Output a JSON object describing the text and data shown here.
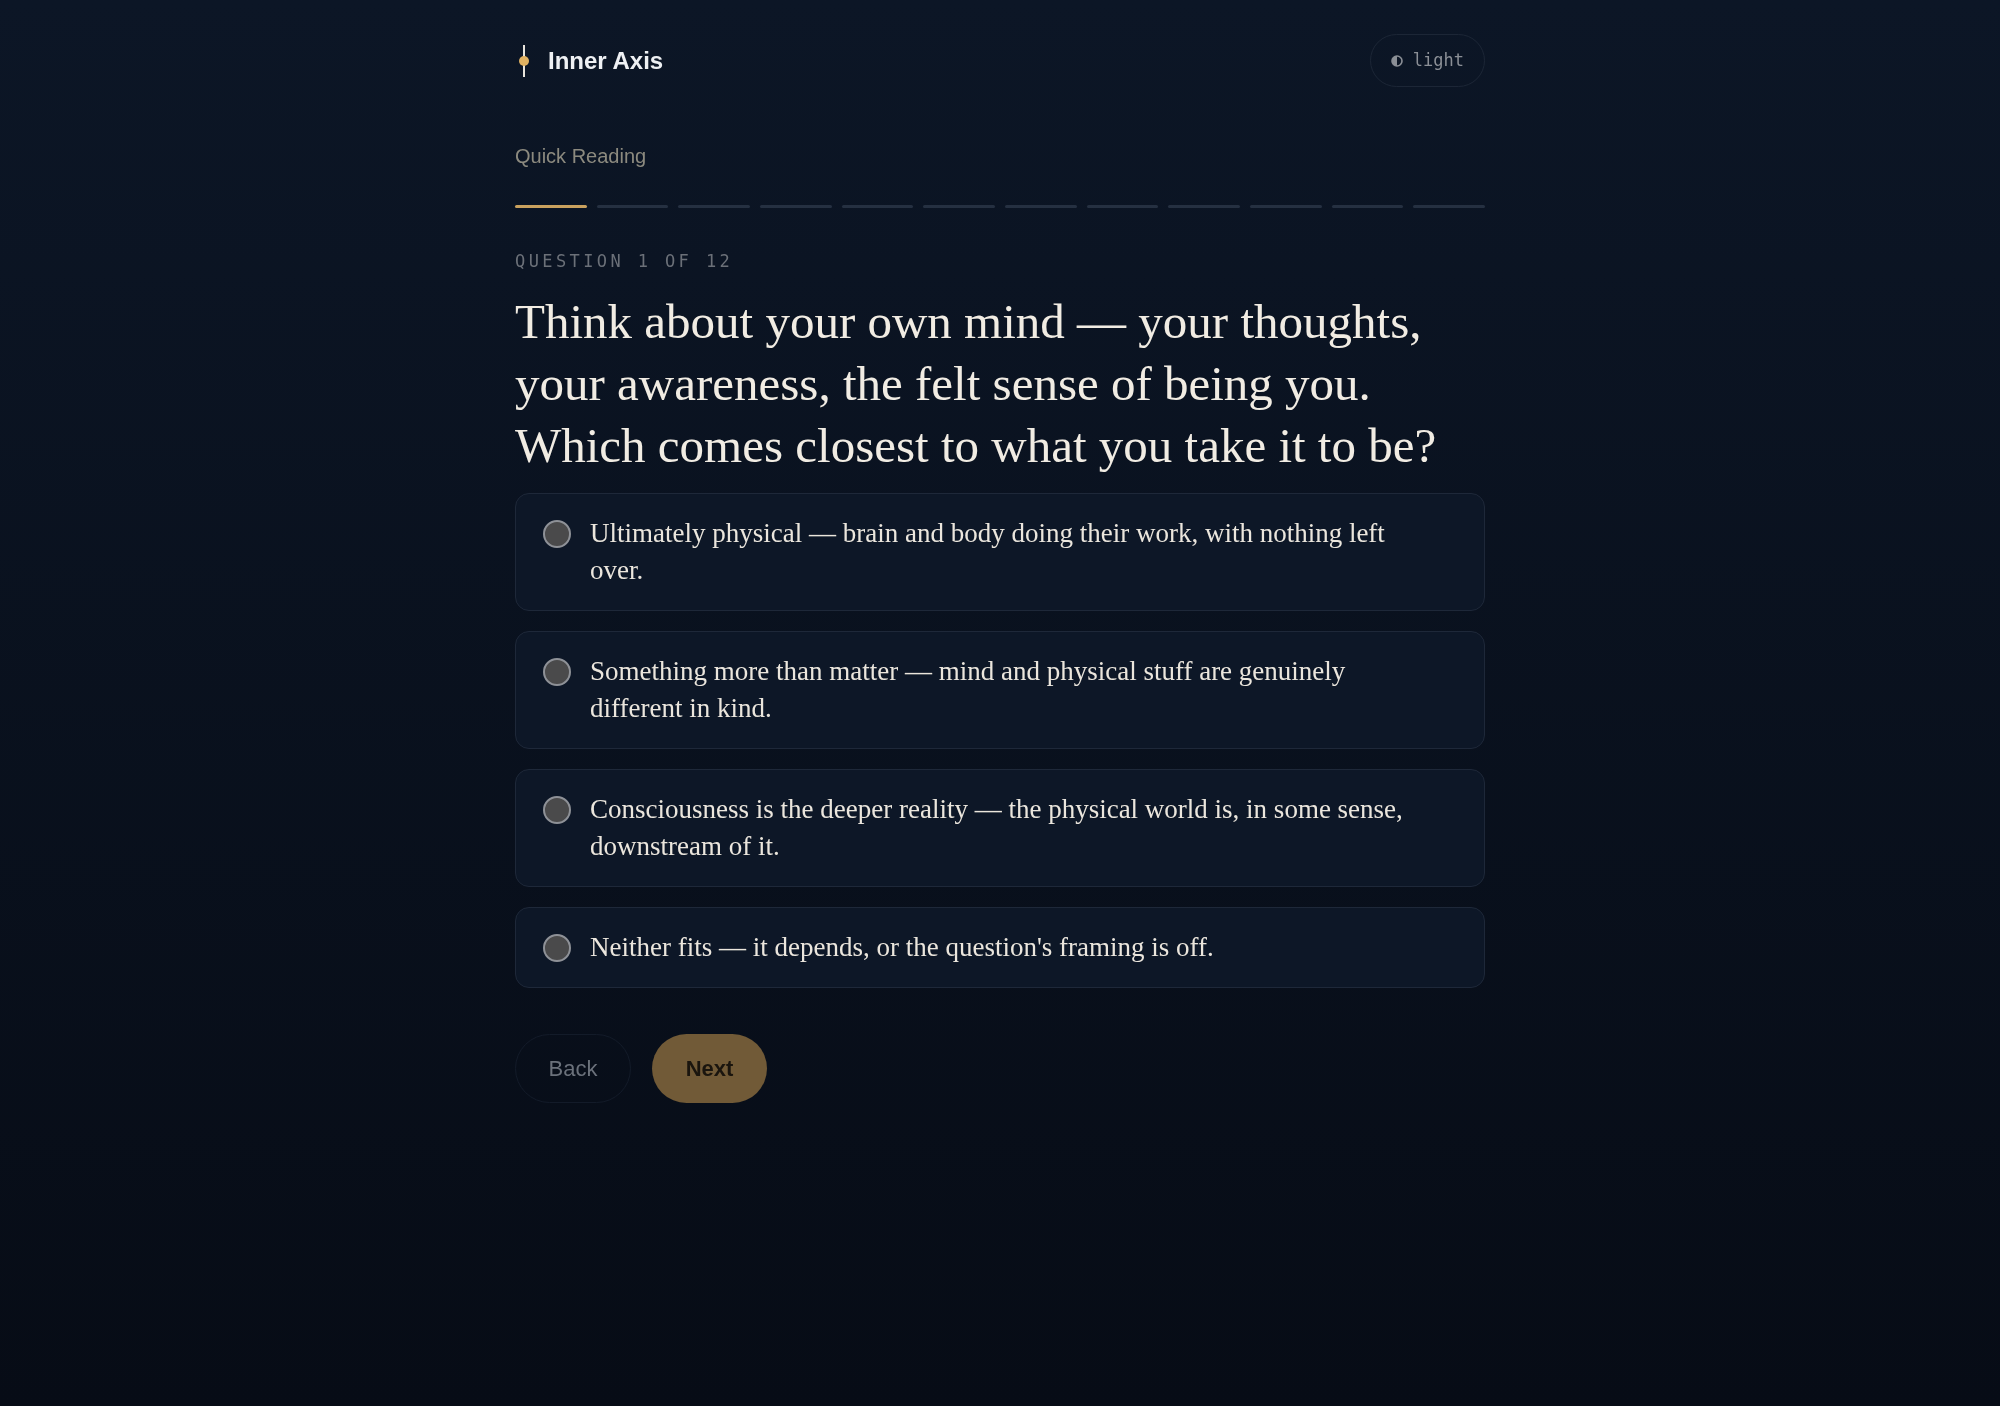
{
  "header": {
    "app_name": "Inner Axis",
    "theme_toggle": {
      "label": "light"
    }
  },
  "quiz": {
    "title": "Quick Reading",
    "progress_segments": [
      {
        "done": true
      },
      {
        "done": false
      },
      {
        "done": false
      },
      {
        "done": false
      },
      {
        "done": false
      },
      {
        "done": false
      },
      {
        "done": false
      },
      {
        "done": false
      },
      {
        "done": false
      },
      {
        "done": false
      },
      {
        "done": false
      },
      {
        "done": false
      }
    ],
    "counter": "QUESTION 1 OF 12",
    "question": "Think about your own mind — your thoughts, your awareness, the felt sense of being you. Which comes closest to what you take it to be?",
    "options": [
      {
        "text": "Ultimately physical — brain and body doing their work, with nothing left over.",
        "selected": false
      },
      {
        "text": "Something more than matter — mind and physical stuff are genuinely different in kind.",
        "selected": false
      },
      {
        "text": "Consciousness is the deeper reality — the physical world is, in some sense, downstream of it.",
        "selected": false
      },
      {
        "text": "Neither fits — it depends, or the question's framing is off.",
        "selected": false
      }
    ],
    "buttons": [
      {
        "label": "Back",
        "kind": "secondary"
      },
      {
        "label": "Next",
        "kind": "primary"
      }
    ]
  }
}
